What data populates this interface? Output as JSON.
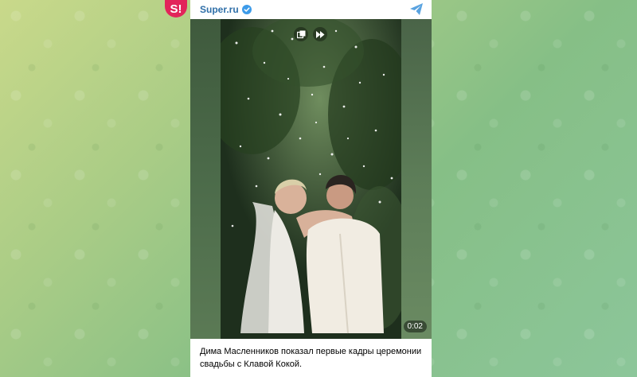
{
  "channel": {
    "name": "Super.ru",
    "avatar_text": "S!"
  },
  "video": {
    "duration": "0:02"
  },
  "caption": "Дима Масленников показал первые кадры церемонии свадьбы с Клавой Кокой.",
  "colors": {
    "channel_name": "#2f6fa8",
    "avatar": "#e2245a",
    "share_icon": "#5aa3e0"
  }
}
